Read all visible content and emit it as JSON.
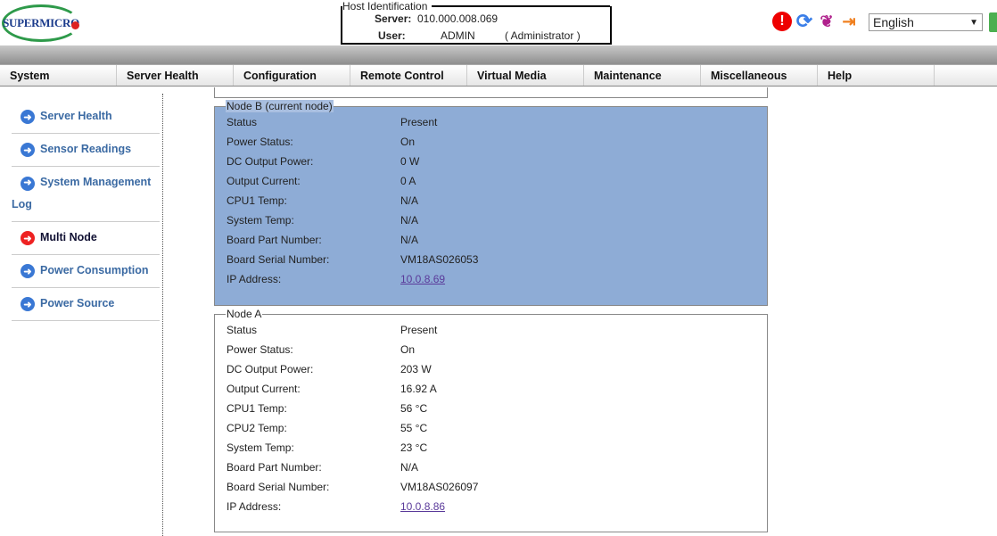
{
  "brand": "SUPERMICRO",
  "host": {
    "legend": "Host Identification",
    "server_label": "Server:",
    "server": "010.000.008.069",
    "user_label": "User:",
    "user": "ADMIN",
    "role": "( Administrator )"
  },
  "language": "English",
  "menu": [
    "System",
    "Server Health",
    "Configuration",
    "Remote Control",
    "Virtual Media",
    "Maintenance",
    "Miscellaneous",
    "Help"
  ],
  "sidebar": [
    {
      "label": "Server Health",
      "active": false
    },
    {
      "label": "Sensor Readings",
      "active": false
    },
    {
      "label": "System Management Log",
      "active": false
    },
    {
      "label": "Multi Node",
      "active": true
    },
    {
      "label": "Power Consumption",
      "active": false
    },
    {
      "label": "Power Source",
      "active": false
    }
  ],
  "nodes": [
    {
      "title": "Node B (current node)",
      "rows": [
        [
          "Status",
          "Present"
        ],
        [
          "Power Status:",
          "On"
        ],
        [
          "DC Output Power:",
          "0 W"
        ],
        [
          "Output Current:",
          "0 A"
        ],
        [
          "CPU1 Temp:",
          "N/A"
        ],
        [
          "System Temp:",
          "N/A"
        ],
        [
          "Board Part Number:",
          "N/A"
        ],
        [
          "Board Serial Number:",
          "VM18AS026053"
        ],
        [
          "IP Address:",
          "10.0.8.69"
        ]
      ]
    },
    {
      "title": "Node A",
      "rows": [
        [
          "Status",
          "Present"
        ],
        [
          "Power Status:",
          "On"
        ],
        [
          "DC Output Power:",
          "203 W"
        ],
        [
          "Output Current:",
          "16.92 A"
        ],
        [
          "CPU1 Temp:",
          "56 °C"
        ],
        [
          "CPU2 Temp:",
          "55 °C"
        ],
        [
          "System Temp:",
          "23 °C"
        ],
        [
          "Board Part Number:",
          "N/A"
        ],
        [
          "Board Serial Number:",
          "VM18AS026097"
        ],
        [
          "IP Address:",
          "10.0.8.86"
        ]
      ]
    }
  ]
}
